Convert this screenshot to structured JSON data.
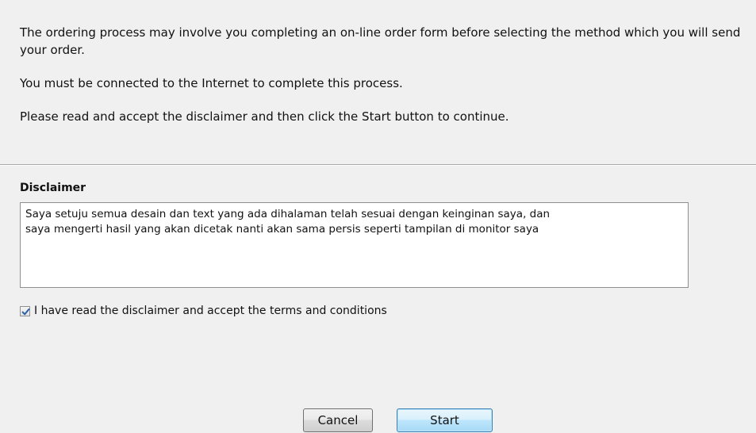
{
  "intro": {
    "line1": "The ordering process may involve you completing an on-line order form before selecting the method which you will send your order.",
    "line2": "You must be connected to the Internet to complete this process.",
    "line3": "Please read and accept the disclaimer and then click the Start button to continue."
  },
  "disclaimer": {
    "label": "Disclaimer",
    "text": "Saya setuju semua desain dan text yang ada dihalaman telah sesuai dengan keinginan saya, dan\nsaya mengerti hasil yang akan dicetak nanti akan sama persis seperti tampilan di monitor saya"
  },
  "accept": {
    "checked": true,
    "label": "I have read the disclaimer and accept the terms and conditions",
    "icon": "checkmark-icon"
  },
  "buttons": {
    "cancel": "Cancel",
    "start": "Start"
  },
  "colors": {
    "background": "#f0f0f0",
    "start_border": "#3c7fb1",
    "check_mark": "#2b5fa8"
  }
}
